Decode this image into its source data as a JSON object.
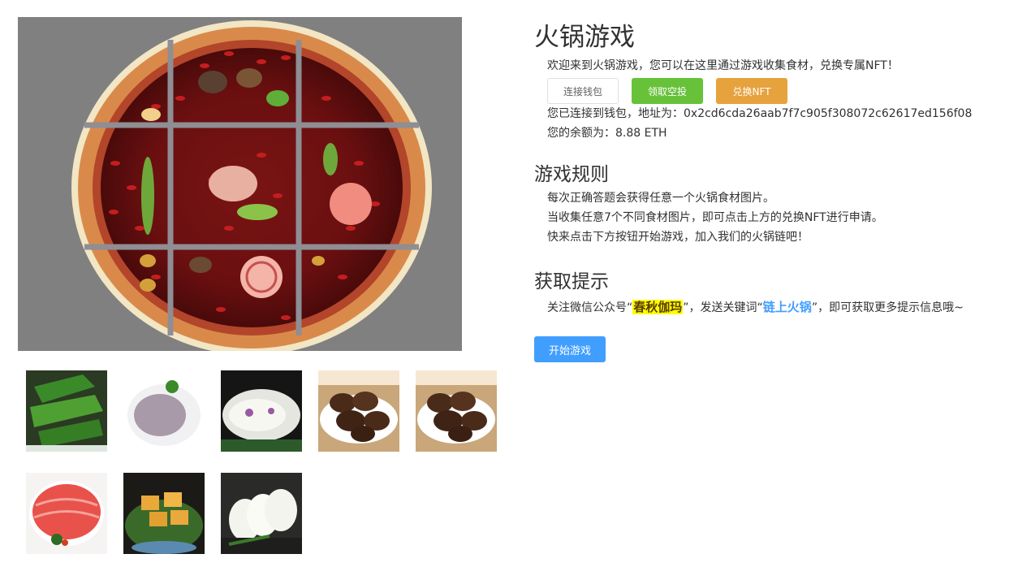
{
  "header": {
    "title": "火锅游戏",
    "welcome": "欢迎来到火锅游戏，您可以在这里通过游戏收集食材，兑换专属NFT！"
  },
  "actions": {
    "connect_wallet": "连接钱包",
    "claim_airdrop": "领取空投",
    "redeem_nft": "兑换NFT"
  },
  "wallet": {
    "address_line": "您已连接到钱包，地址为：0x2cd6cda26aab7f7c905f308072c62617ed156f08",
    "balance_line": "您的余额为：8.88 ETH"
  },
  "rules": {
    "heading": "游戏规则",
    "lines": [
      "每次正确答题会获得任意一个火锅食材图片。",
      "当收集任意7个不同食材图片，即可点击上方的兑换NFT进行申请。",
      "快来点击下方按钮开始游戏，加入我们的火锅链吧！"
    ]
  },
  "tips": {
    "heading": "获取提示",
    "prefix": "关注微信公众号“",
    "account": "春秋伽玛",
    "middle": "”，发送关键词“",
    "keyword": "链上火锅",
    "suffix": "”，即可获取更多提示信息哦~"
  },
  "start_button": "开始游戏",
  "ingredients": [
    {
      "icon": "green-pepper-image"
    },
    {
      "icon": "shrimp-paste-image"
    },
    {
      "icon": "squid-slices-image"
    },
    {
      "icon": "shiitake-mushroom-image"
    },
    {
      "icon": "shiitake-mushroom-image"
    },
    {
      "icon": "beef-rolls-image"
    },
    {
      "icon": "fried-tofu-image"
    },
    {
      "icon": "white-radish-image"
    }
  ],
  "colors": {
    "primary": "#409eff",
    "success": "#67c23a",
    "warning": "#e6a23c",
    "hero_bg": "#808080"
  }
}
